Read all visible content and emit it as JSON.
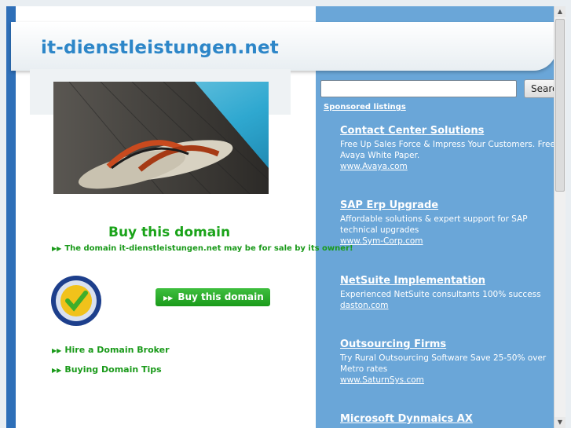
{
  "header": {
    "site_title": "it-dienstleistungen.net"
  },
  "left": {
    "buy_heading": "Buy this domain",
    "sale_text": "The domain it-dienstleistungen.net may be for sale by its owner!",
    "buy_button_label": "Buy this domain",
    "links": [
      {
        "label": "Hire a Domain Broker"
      },
      {
        "label": "Buying Domain Tips"
      }
    ],
    "seal_text": "Safe Buyer Protection · Save & Secure"
  },
  "search": {
    "placeholder": "",
    "button_label": "Search"
  },
  "sponsored_label": "Sponsored listings",
  "ads": [
    {
      "title": "Contact Center Solutions",
      "desc": "Free Up Sales Force & Impress Your Customers. Free Avaya White Paper.",
      "url": "www.Avaya.com"
    },
    {
      "title": "SAP Erp Upgrade",
      "desc": "Affordable solutions & expert support for SAP technical upgrades",
      "url": "www.Sym-Corp.com"
    },
    {
      "title": "NetSuite Implementation",
      "desc": "Experienced NetSuite consultants 100% success",
      "url": "daston.com"
    },
    {
      "title": "Outsourcing Firms",
      "desc": "Try Rural Outsourcing Software Save 25-50% over Metro rates",
      "url": "www.SaturnSys.com"
    },
    {
      "title": "Microsoft Dynmaics AX",
      "desc": "",
      "url": ""
    }
  ],
  "colors": {
    "brand_blue": "#2d86c8",
    "green": "#1aa319",
    "panel_blue": "#6aa6d8"
  }
}
